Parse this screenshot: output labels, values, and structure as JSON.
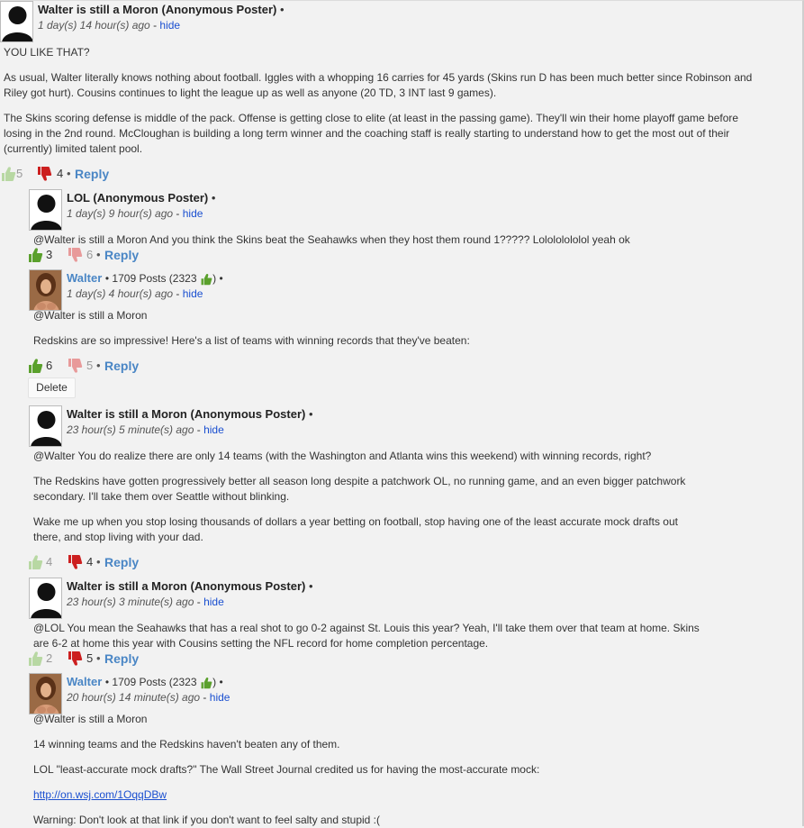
{
  "colors": {
    "accent": "#4a86c5",
    "link": "#1a4fd0",
    "thumb_up": "#5aa02c",
    "thumb_down": "#cc1f1f"
  },
  "comments": [
    {
      "author": "Walter is still a Moron (Anonymous Poster)",
      "time": "1 day(s) 14 hour(s) ago",
      "hide": "hide",
      "paragraphs": [
        "YOU LIKE THAT?",
        "As usual, Walter literally knows nothing about football. Iggles with a whopping 16 carries for 45 yards (Skins run D has been much better since Robinson and Riley got hurt). Cousins continues to light the league up as well as anyone (20 TD, 3 INT last 9 games).",
        "The Skins scoring defense is middle of the pack. Offense is getting close to elite (at least in the passing game). They'll win their home playoff game before losing in the 2nd round. McCloughan is building a long term winner and the coaching staff is really starting to understand how to get the most out of their (currently) limited talent pool."
      ],
      "up": "5",
      "down": "4",
      "reply": "Reply"
    },
    {
      "author": "LOL (Anonymous Poster)",
      "time": "1 day(s) 9 hour(s) ago",
      "hide": "hide",
      "paragraphs": [
        "@Walter is still a Moron And you think the Skins beat the Seahawks when they host them round 1????? Lolololololol yeah ok"
      ],
      "up": "3",
      "down": "6",
      "reply": "Reply"
    },
    {
      "author": "Walter",
      "posts": "1709 Posts (2323",
      "time": "1 day(s) 4 hour(s) ago",
      "hide": "hide",
      "paragraphs": [
        "@Walter is still a Moron",
        "Redskins are so impressive! Here's a list of teams with winning records that they've beaten:"
      ],
      "up": "6",
      "down": "5",
      "reply": "Reply",
      "delete": "Delete"
    },
    {
      "author": "Walter is still a Moron (Anonymous Poster)",
      "time": "23 hour(s) 5 minute(s) ago",
      "hide": "hide",
      "paragraphs": [
        "@Walter You do realize there are only 14 teams (with the Washington and Atlanta wins this weekend) with winning records, right?",
        "The Redskins have gotten progressively better all season long despite a patchwork OL, no running game, and an even bigger patchwork secondary. I'll take them over Seattle without blinking.",
        "Wake me up when you stop losing thousands of dollars a year betting on football, stop having one of the least accurate mock drafts out there, and stop living with your dad."
      ],
      "up": "4",
      "down": "4",
      "reply": "Reply"
    },
    {
      "author": "Walter is still a Moron (Anonymous Poster)",
      "time": "23 hour(s) 3 minute(s) ago",
      "hide": "hide",
      "paragraphs": [
        "@LOL You mean the Seahawks that has a real shot to go 0-2 against St. Louis this year? Yeah, I'll take them over that team at home. Skins are 6-2 at home this year with Cousins setting the NFL record for home completion percentage."
      ],
      "up": "2",
      "down": "5",
      "reply": "Reply"
    },
    {
      "author": "Walter",
      "posts": "1709 Posts (2323",
      "time": "20 hour(s) 14 minute(s) ago",
      "hide": "hide",
      "paragraphs": [
        "@Walter is still a Moron",
        "14 winning teams and the Redskins haven't beaten any of them.",
        "LOL \"least-accurate mock drafts?\" The Wall Street Journal credited us for having the most-accurate mock:",
        "http://on.wsj.com/1OqqDBw",
        "Warning: Don't look at that link if you don't want to feel salty and stupid :("
      ]
    }
  ]
}
